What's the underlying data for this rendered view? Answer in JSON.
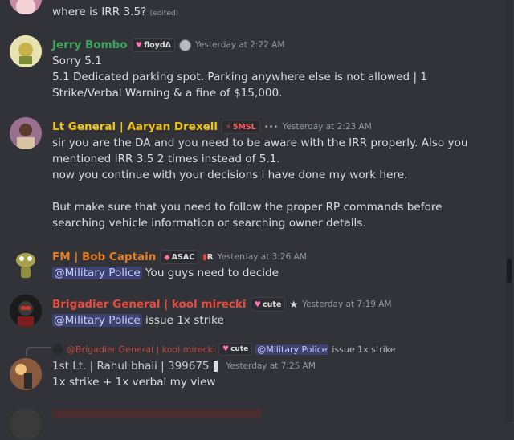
{
  "messages": [
    {
      "text_lines": [
        "where is IRR 3.5?"
      ],
      "edited": "(edited)"
    },
    {
      "author": "Jerry Bombo",
      "badge": "floydΔ",
      "timestamp": "Yesterday at 2:22 AM",
      "text_lines": [
        "Sorry 5.1",
        "5.1 Dedicated parking spot. Parking anywhere else is not allowed | 1 Strike/Verbal Warning & a fine of $15,000."
      ]
    },
    {
      "author": "Lt General | Aaryan Drexell",
      "badge": "5MSL",
      "timestamp": "Yesterday at 2:23 AM",
      "text_lines": [
        "sir you are the DA and you need to be aware with the IRR properly. Also you mentioned IRR 3.5 2 times instead of 5.1.",
        "now you continue with your decisions i have done my work here.",
        "But make sure that you need to follow the proper RP commands before searching vehicle information or searching owner details."
      ]
    },
    {
      "author": "FM | Bob Captain",
      "badge": "ASAC",
      "badge2": "R",
      "timestamp": "Yesterday at 3:26 AM",
      "mention": "@Military Police",
      "text": "You guys need to decide"
    },
    {
      "author": "Brigadier General | kool mirecki",
      "badge": "cute",
      "timestamp": "Yesterday at 7:19 AM",
      "mention": "@Military Police",
      "text": "issue 1x strike"
    },
    {
      "reply": {
        "author": "@Brigadier General | kool mirecki",
        "badge": "cute",
        "mention": "@Military Police",
        "text": "issue 1x strike"
      },
      "author": "1st Lt. | Rahul bhaii | 399675",
      "timestamp": "Yesterday at 7:25 AM",
      "text": "1x strike + 1x verbal my view"
    }
  ],
  "colors": {
    "background": "#313338",
    "jerry": "#3ba55c",
    "drexell": "#f1c40f",
    "bob": "#e67e22",
    "brigadier": "#e74c3c",
    "rahul": "#c7ccd1",
    "mention_bg": "#3c4270"
  }
}
